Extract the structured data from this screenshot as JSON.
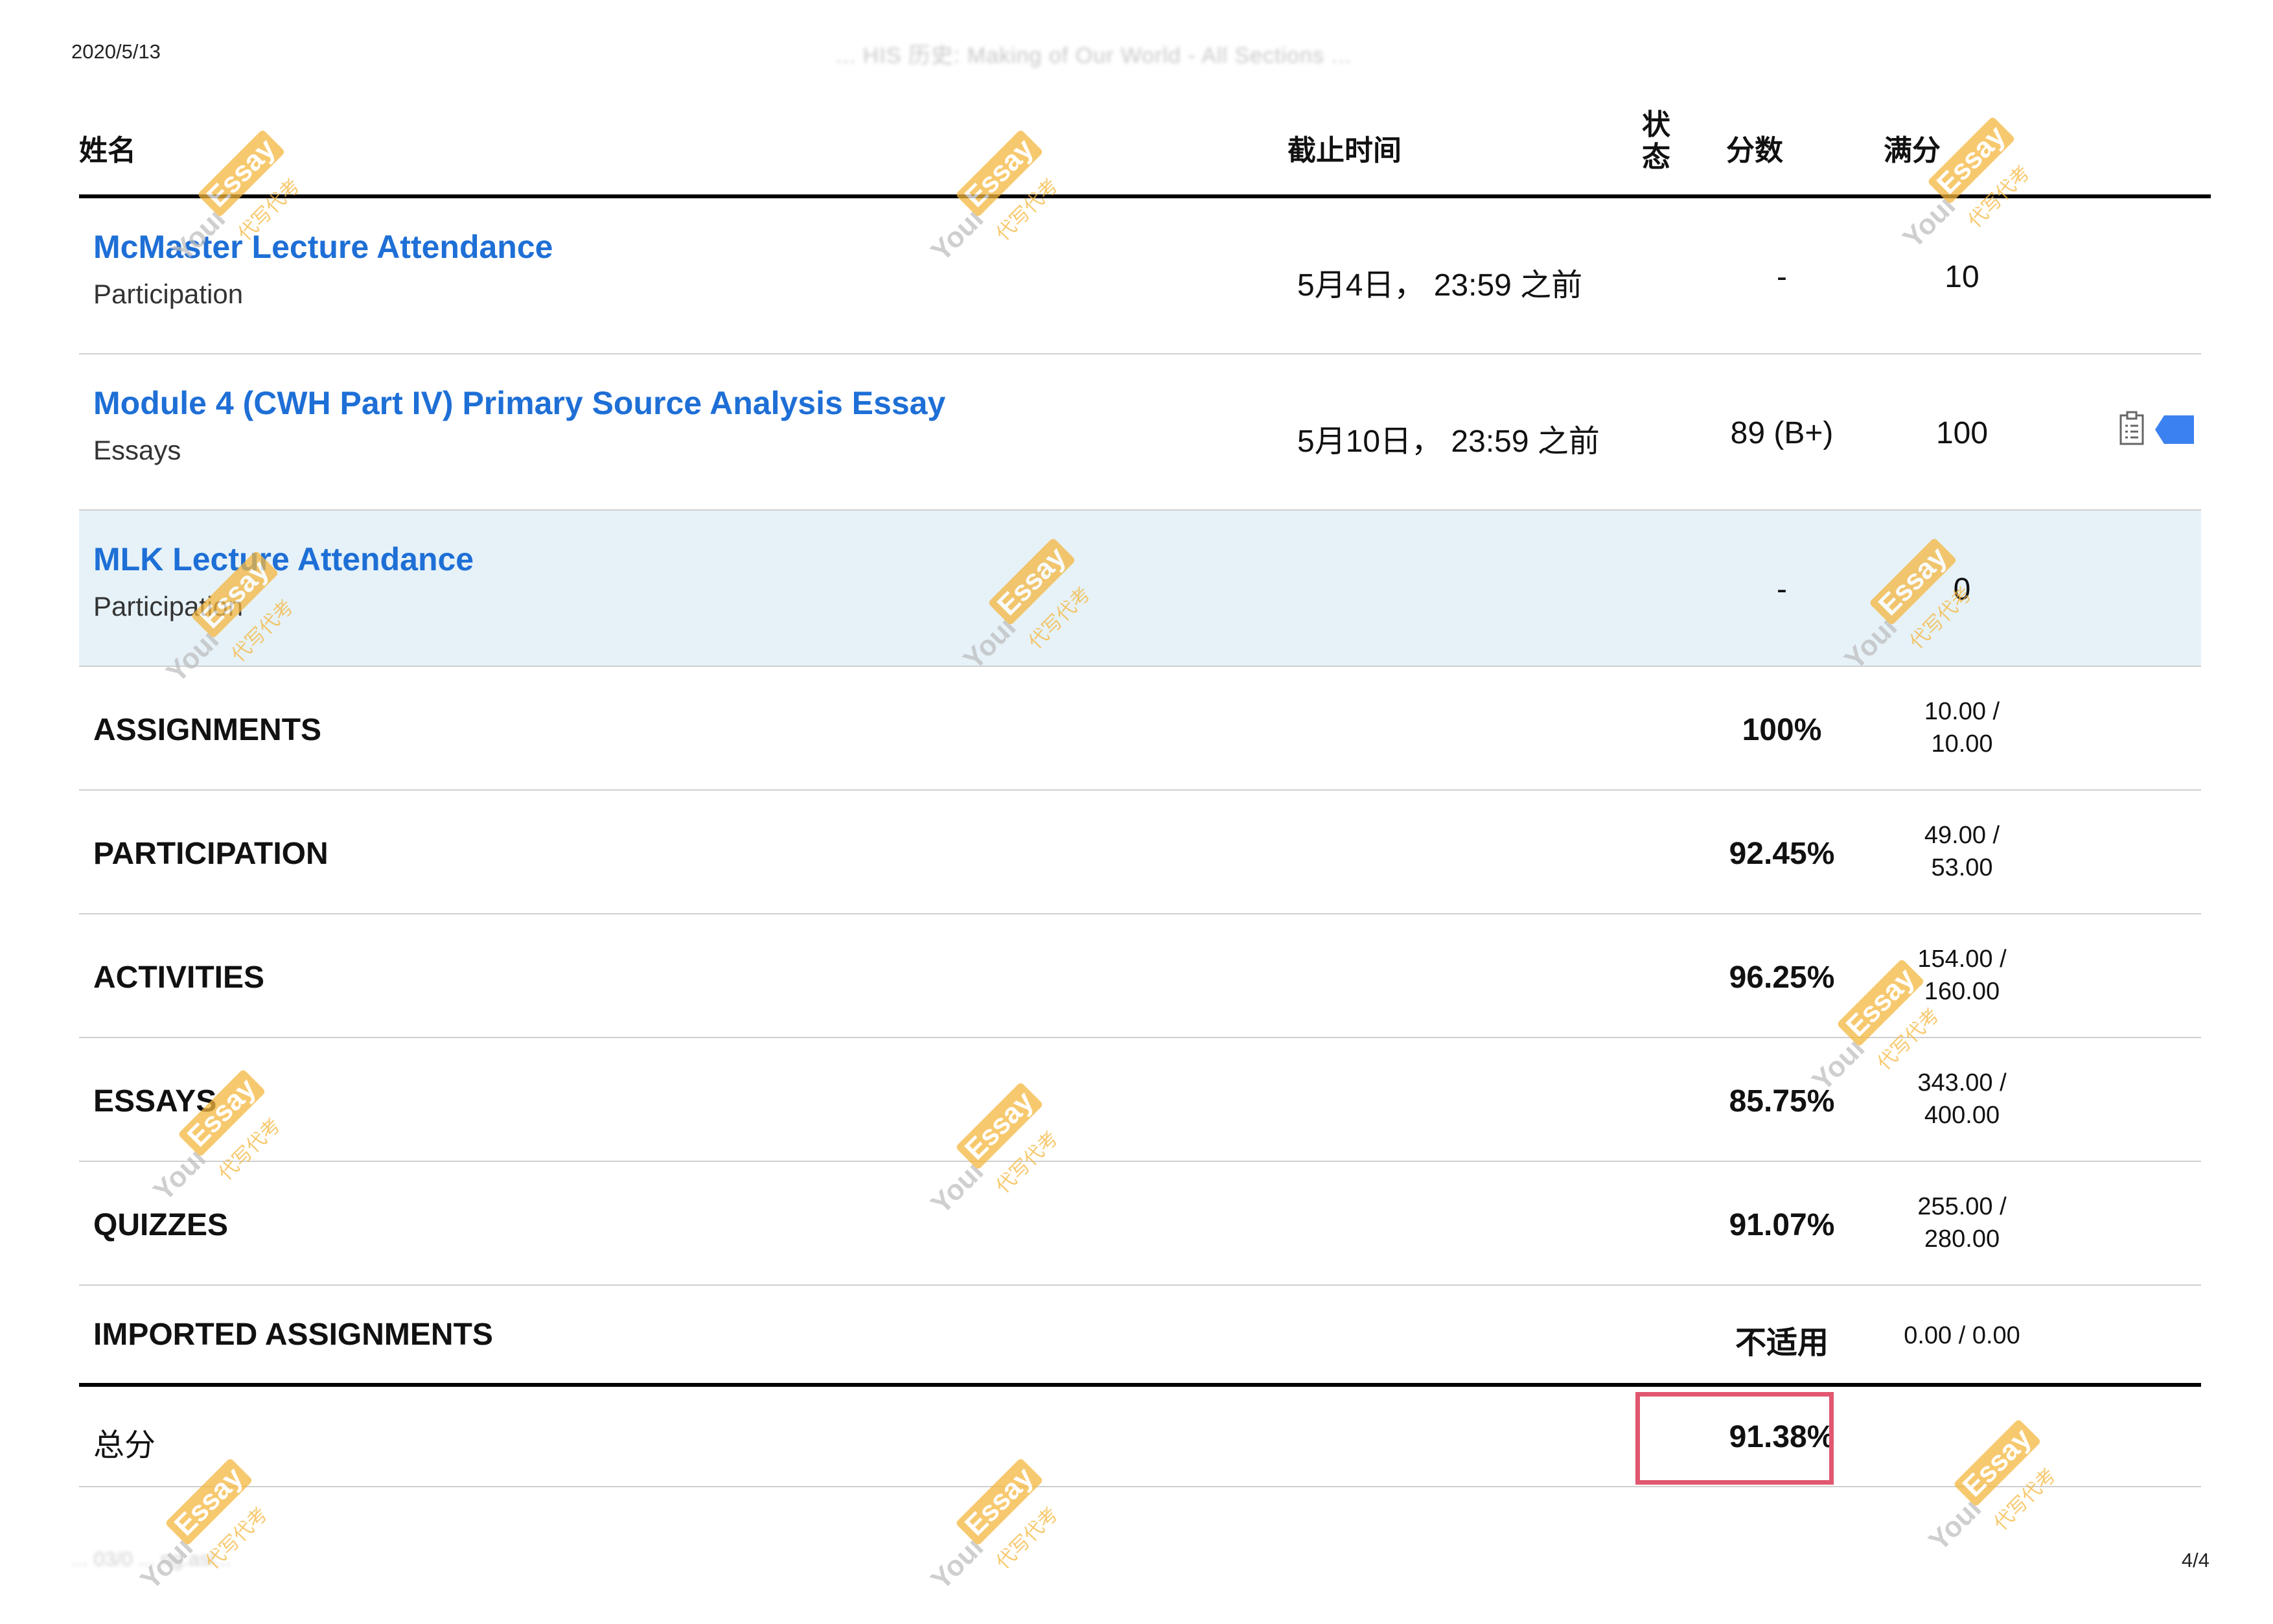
{
  "header": {
    "date": "2020/5/13",
    "title": "... HIS 历史: Making of Our World - All Sections ..."
  },
  "footer": {
    "left": "... 03/0 ... ng.asl...",
    "page": "4/4"
  },
  "columns": {
    "name": "姓名",
    "due": "截止时间",
    "status": "状态",
    "score": "分数",
    "max": "满分"
  },
  "assignments": [
    {
      "title": "McMaster Lecture Attendance",
      "category": "Participation",
      "due": "5月4日， 23:59 之前",
      "score": "-",
      "max": "10"
    },
    {
      "title": "Module 4 (CWH Part IV) Primary Source Analysis Essay",
      "category": "Essays",
      "due": "5月10日， 23:59 之前",
      "score": "89 (B+)",
      "max": "100"
    },
    {
      "title": "MLK Lecture Attendance",
      "category": "Participation",
      "due": "",
      "score": "-",
      "max": "0"
    }
  ],
  "groups": [
    {
      "name": "ASSIGNMENTS",
      "percent": "100%",
      "fraction": "10.00 / 10.00"
    },
    {
      "name": "PARTICIPATION",
      "percent": "92.45%",
      "fraction": "49.00 / 53.00"
    },
    {
      "name": "ACTIVITIES",
      "percent": "96.25%",
      "fraction": "154.00 / 160.00"
    },
    {
      "name": "ESSAYS",
      "percent": "85.75%",
      "fraction": "343.00 / 400.00"
    },
    {
      "name": "QUIZZES",
      "percent": "91.07%",
      "fraction": "255.00 / 280.00"
    },
    {
      "name": "IMPORTED ASSIGNMENTS",
      "percent": "不适用",
      "fraction": "0.00 / 0.00"
    }
  ],
  "total": {
    "label": "总分",
    "percent": "91.38%"
  },
  "watermark": {
    "brand": "Your",
    "badge": "Essay",
    "sub": "代写代考"
  },
  "colors": {
    "link": "#1e6fd6",
    "highlight_row": "#e6f2f8",
    "total_box": "#e0576f",
    "watermark": "#f5b73f"
  }
}
